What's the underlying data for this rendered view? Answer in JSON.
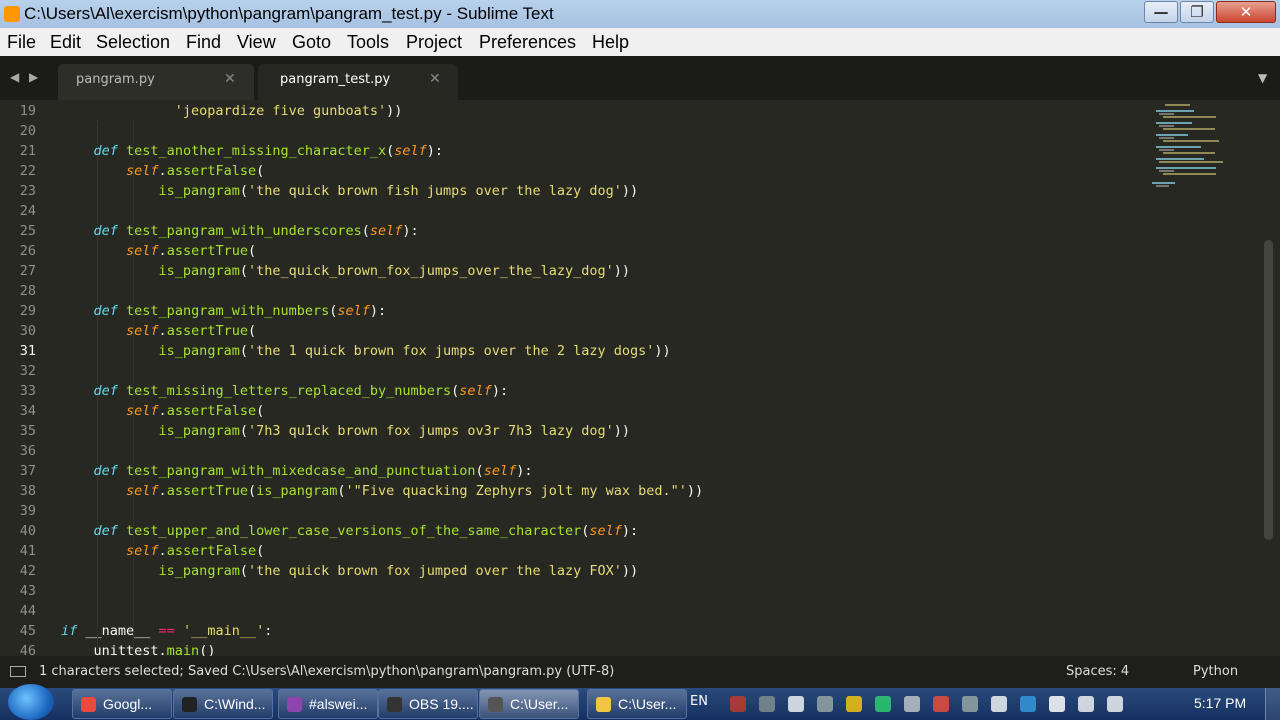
{
  "window": {
    "title": "C:\\Users\\Al\\exercism\\python\\pangram\\pangram_test.py - Sublime Text",
    "minimize_glyph": "—",
    "maximize_glyph": "❐",
    "close_glyph": "✕"
  },
  "menu": [
    "File",
    "Edit",
    "Selection",
    "Find",
    "View",
    "Goto",
    "Tools",
    "Project",
    "Preferences",
    "Help"
  ],
  "tabs": [
    {
      "label": "pangram.py",
      "close": "✕"
    },
    {
      "label": "pangram_test.py",
      "close": "✕"
    }
  ],
  "nav": {
    "back": "◀",
    "forward": "▶",
    "overflow": "▼"
  },
  "editor": {
    "active_line": "31",
    "lines": [
      {
        "n": "19",
        "code": "              'jeopardize five gunboats'))"
      },
      {
        "n": "20",
        "code": ""
      },
      {
        "n": "21",
        "code": "    def test_another_missing_character_x(self):"
      },
      {
        "n": "22",
        "code": "        self.assertFalse("
      },
      {
        "n": "23",
        "code": "            is_pangram('the quick brown fish jumps over the lazy dog'))"
      },
      {
        "n": "24",
        "code": ""
      },
      {
        "n": "25",
        "code": "    def test_pangram_with_underscores(self):"
      },
      {
        "n": "26",
        "code": "        self.assertTrue("
      },
      {
        "n": "27",
        "code": "            is_pangram('the_quick_brown_fox_jumps_over_the_lazy_dog'))"
      },
      {
        "n": "28",
        "code": ""
      },
      {
        "n": "29",
        "code": "    def test_pangram_with_numbers(self):"
      },
      {
        "n": "30",
        "code": "        self.assertTrue("
      },
      {
        "n": "31",
        "code": "            is_pangram('the 1 quick brown fox jumps over the 2 lazy dogs'))"
      },
      {
        "n": "32",
        "code": ""
      },
      {
        "n": "33",
        "code": "    def test_missing_letters_replaced_by_numbers(self):"
      },
      {
        "n": "34",
        "code": "        self.assertFalse("
      },
      {
        "n": "35",
        "code": "            is_pangram('7h3 qu1ck brown fox jumps ov3r 7h3 lazy dog'))"
      },
      {
        "n": "36",
        "code": ""
      },
      {
        "n": "37",
        "code": "    def test_pangram_with_mixedcase_and_punctuation(self):"
      },
      {
        "n": "38",
        "code": "        self.assertTrue(is_pangram('\"Five quacking Zephyrs jolt my wax bed.\"'))"
      },
      {
        "n": "39",
        "code": ""
      },
      {
        "n": "40",
        "code": "    def test_upper_and_lower_case_versions_of_the_same_character(self):"
      },
      {
        "n": "41",
        "code": "        self.assertFalse("
      },
      {
        "n": "42",
        "code": "            is_pangram('the quick brown fox jumped over the lazy FOX'))"
      },
      {
        "n": "43",
        "code": ""
      },
      {
        "n": "44",
        "code": ""
      },
      {
        "n": "45",
        "code": "if __name__ == '__main__':"
      },
      {
        "n": "46",
        "code": "    unittest.main()"
      }
    ]
  },
  "status": {
    "message": "1 characters selected; Saved C:\\Users\\Al\\exercism\\python\\pangram\\pangram.py (UTF-8)",
    "spaces": "Spaces: 4",
    "syntax": "Python"
  },
  "taskbar": {
    "buttons": [
      {
        "label": "Googl...",
        "color": "#e84a3b"
      },
      {
        "label": "C:\\Wind...",
        "color": "#222222"
      },
      {
        "label": "#alswei...",
        "color": "#8e44ad"
      },
      {
        "label": "OBS 19....",
        "color": "#333333"
      },
      {
        "label": "C:\\User...",
        "color": "#555555"
      },
      {
        "label": "C:\\User...",
        "color": "#f4c542"
      }
    ],
    "language": "EN",
    "clock": "5:17 PM"
  },
  "colors": {
    "keyword": "#66d9ef",
    "function": "#a6e22e",
    "self": "#fd971f",
    "string": "#e6db74",
    "operator": "#f92672",
    "background": "#272822"
  }
}
